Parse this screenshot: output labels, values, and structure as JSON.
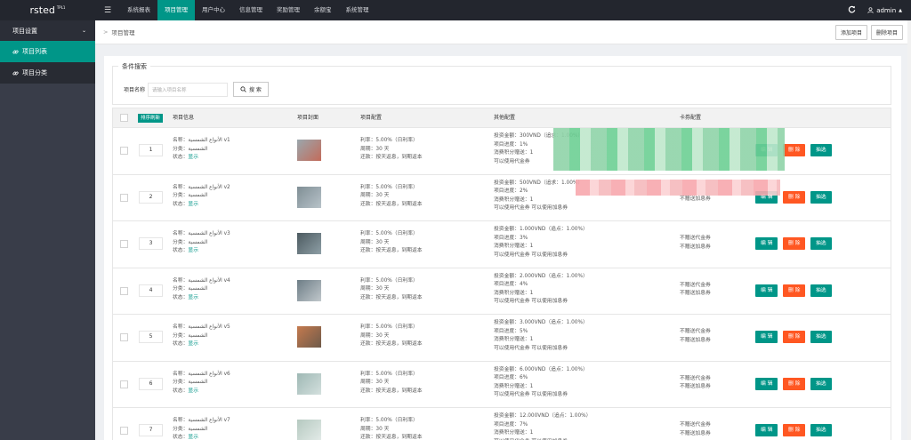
{
  "app": {
    "logo": "rsted",
    "logo_sup": "TPL1",
    "menu_icon": "☰",
    "refresh_icon": "C",
    "user": "admin"
  },
  "nav": [
    "系统报表",
    "项目管理",
    "用户中心",
    "信息管理",
    "奖励管理",
    "余额宝",
    "系统管理"
  ],
  "sidebar": {
    "group": "项目设置",
    "items": [
      {
        "label": "项目列表",
        "active": true
      },
      {
        "label": "项目分类",
        "active": false
      }
    ]
  },
  "breadcrumb": {
    "current": "项目管理"
  },
  "actions": {
    "add": "添加项目",
    "delete": "删除项目"
  },
  "search": {
    "legend": "条件搜索",
    "label": "项目名称",
    "placeholder": "请输入项目名称",
    "button": "搜 索"
  },
  "table": {
    "headers": {
      "sort": "排序刷新",
      "info": "项目信息",
      "cover": "项目封面",
      "config": "项目配置",
      "other": "其他配置",
      "coupon": "卡券配置"
    },
    "buttons": {
      "edit": "编 辑",
      "delete": "删 除",
      "coupon": "抽选"
    },
    "rows": [
      {
        "sort": "1",
        "name": "名称：الأنواع الشمسية v1",
        "category": "分类：",
        "category_value": "الشمسية",
        "status_label": "状态：",
        "status": "显示",
        "rate": "利率：5.00%（日利率）",
        "period": "周期：30 天",
        "repay": "还款：按天返息，到期返本",
        "other": [
          "投资金额：300VND（追求：1.00%）",
          "项目进度：1%",
          "消费积分赠送：1",
          "可以使用代金券"
        ],
        "coupon": [],
        "thumb": [
          "#9aa7ad",
          "#c36b5a"
        ]
      },
      {
        "sort": "2",
        "name": "名称：الأنواع الشمسية v2",
        "category": "分类：",
        "category_value": "الشمسية",
        "status_label": "状态：",
        "status": "显示",
        "rate": "利率：5.00%（日利率）",
        "period": "周期：30 天",
        "repay": "还款：按天返息，到期返本",
        "other": [
          "投资金额：500VND（追求：1.00%）",
          "项目进度：2%",
          "消费积分赠送：1",
          "可以使用代金券    可以使用加息券"
        ],
        "coupon": [
          "不赠送加息券"
        ],
        "thumb": [
          "#7f8e95",
          "#b8c3c9"
        ]
      },
      {
        "sort": "3",
        "name": "名称：الأنواع الشمسية v3",
        "category": "分类：",
        "category_value": "الشمسية",
        "status_label": "状态：",
        "status": "显示",
        "rate": "利率：5.00%（日利率）",
        "period": "周期：30 天",
        "repay": "还款：按天返息，到期返本",
        "other": [
          "投资金额：1.000VND（追点：1.00%）",
          "项目进度：3%",
          "消费积分赠送：1",
          "可以使用代金券    可以使用加息券"
        ],
        "coupon": [
          "不赠送代金券",
          "不赠送加息券"
        ],
        "thumb": [
          "#4c5a60",
          "#8e9fa6"
        ]
      },
      {
        "sort": "4",
        "name": "名称：الأنواع الشمسية v4",
        "category": "分类：",
        "category_value": "الشمسية",
        "status_label": "状态：",
        "status": "显示",
        "rate": "利率：5.00%（日利率）",
        "period": "周期：30 天",
        "repay": "还款：按天返息，到期返本",
        "other": [
          "投资金额：2.000VND（追点：1.00%）",
          "项目进度：4%",
          "消费积分赠送：1",
          "可以使用代金券    可以使用加息券"
        ],
        "coupon": [
          "不赠送代金券",
          "不赠送加息券"
        ],
        "thumb": [
          "#6d7d86",
          "#c1c8cc"
        ]
      },
      {
        "sort": "5",
        "name": "名称：الأنواع الشمسية v5",
        "category": "分类：",
        "category_value": "الشمسية",
        "status_label": "状态：",
        "status": "显示",
        "rate": "利率：5.00%（日利率）",
        "period": "周期：30 天",
        "repay": "还款：按天返息，到期返本",
        "other": [
          "投资金额：3.000VND（追点：1.00%）",
          "项目进度：5%",
          "消费积分赠送：1",
          "可以使用代金券    可以使用加息券"
        ],
        "coupon": [
          "不赠送代金券",
          "不赠送加息券"
        ],
        "thumb": [
          "#c57a4e",
          "#6e5a4a"
        ]
      },
      {
        "sort": "6",
        "name": "名称：الأنواع الشمسية v6",
        "category": "分类：",
        "category_value": "الشمسية",
        "status_label": "状态：",
        "status": "显示",
        "rate": "利率：5.00%（日利率）",
        "period": "周期：30 天",
        "repay": "还款：按天返息，到期返本",
        "other": [
          "投资金额：6.000VND（追点：1.00%）",
          "项目进度：6%",
          "消费积分赠送：1",
          "可以使用代金券    可以使用加息券"
        ],
        "coupon": [
          "不赠送代金券",
          "不赠送加息券"
        ],
        "thumb": [
          "#9eb8b4",
          "#d4e0de"
        ]
      },
      {
        "sort": "7",
        "name": "名称：الأنواع الشمسية v7",
        "category": "分类：",
        "category_value": "الشمسية",
        "status_label": "状态：",
        "status": "显示",
        "rate": "利率：5.00%（日利率）",
        "period": "周期：30 天",
        "repay": "还款：按天返息，到期返本",
        "other": [
          "投资金额：12.000VND（追点：1.00%）",
          "项目进度：7%",
          "消费积分赠送：1",
          "可以使用代金券    可以使用加息券"
        ],
        "coupon": [
          "不赠送代金券",
          "不赠送加息券"
        ],
        "thumb": [
          "#b5c9c0",
          "#e3ebe8"
        ]
      }
    ]
  }
}
